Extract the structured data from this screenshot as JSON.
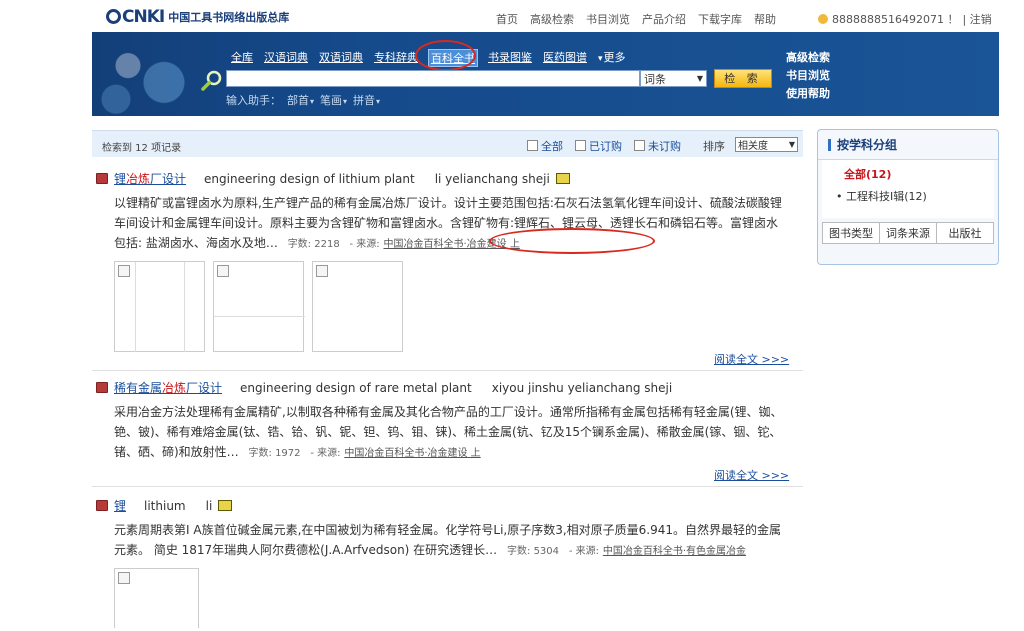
{
  "topbar": {
    "logo_mark": "CNKI",
    "logo_text": "中国工具书网络出版总库",
    "nav": [
      "首页",
      "高级检索",
      "书目浏览",
      "产品介绍",
      "下载字库",
      "帮助"
    ],
    "user": "8888888516492071 ！",
    "logout": "| 注销"
  },
  "banner": {
    "tabs": [
      "全库",
      "汉语词典",
      "双语词典",
      "专科辞典",
      "百科全书",
      "书录图鉴",
      "医药图谱",
      "更多"
    ],
    "active_tab": "百科全书",
    "search_value": "",
    "scope": "词条",
    "search_button": "检 索",
    "assist_label": "输入助手：",
    "assist_items": [
      "部首",
      "笔画",
      "拼音"
    ],
    "right_links": [
      "高级检索",
      "书目浏览",
      "使用帮助"
    ]
  },
  "results_header": {
    "count": "检索到 12 项记录",
    "filter_all": "全部",
    "filter_subscribed": "已订购",
    "filter_unsubscribed": "未订购",
    "sort_label": "排序",
    "sort_value": "相关度"
  },
  "results": [
    {
      "title_pre": "锂",
      "title_hl": "冶炼",
      "title_post": "厂设计",
      "english": "engineering design of lithium plant",
      "pinyin": "li yelianchang sheji",
      "body": "以锂精矿或富锂卤水为原料,生产锂产品的稀有金属冶炼厂设计。设计主要范围包括:石灰石法氢氧化锂车间设计、硫酸法碳酸锂车间设计和金属锂车间设计。原料主要为含锂矿物和富锂卤水。含锂矿物有:锂辉石、锂云母、透锂长石和磷铝石等。富锂卤水包括: 盐湖卤水、海卤水及地…",
      "meta": "字数: 2218",
      "src_label": "- 来源:",
      "source": "中国冶金百科全书·冶金建设 上",
      "readmore": "阅读全文 >>>"
    },
    {
      "title_pre": "稀有金属",
      "title_hl": "冶炼",
      "title_post": "厂设计",
      "english": "engineering design of rare metal plant",
      "pinyin": "xiyou jinshu yelianchang sheji",
      "body": "采用冶金方法处理稀有金属精矿,以制取各种稀有金属及其化合物产品的工厂设计。通常所指稀有金属包括稀有轻金属(锂、铷、铯、铍)、稀有难熔金属(钛、锆、铪、钒、铌、钽、钨、钼、铼)、稀土金属(钪、钇及15个镧系金属)、稀散金属(镓、铟、铊、锗、硒、碲)和放射性…",
      "meta": "字数: 1972",
      "src_label": "- 来源:",
      "source": "中国冶金百科全书·冶金建设 上",
      "readmore": "阅读全文 >>>"
    },
    {
      "title_pre": "锂",
      "title_hl": "",
      "title_post": "",
      "english": "lithium",
      "pinyin": "li",
      "body": "元素周期表第I A族首位碱金属元素,在中国被划为稀有轻金属。化学符号Li,原子序数3,相对原子质量6.941。自然界最轻的金属元素。 简史 1817年瑞典人阿尔费德松(J.A.Arfvedson) 在研究透锂长…",
      "meta": "字数: 5304",
      "src_label": "- 来源:",
      "source": "中国冶金百科全书·有色金属冶金",
      "readmore": ""
    }
  ],
  "side": {
    "title": "按学科分组",
    "all": "全部(12)",
    "category": "工程科技Ⅰ辑(12)",
    "tabs": [
      "图书类型",
      "词条来源",
      "出版社"
    ]
  },
  "colors": {
    "banner": "#154a8b",
    "highlight": "#c8161d",
    "link": "#1a4e9c",
    "annotation": "#d8291f"
  }
}
